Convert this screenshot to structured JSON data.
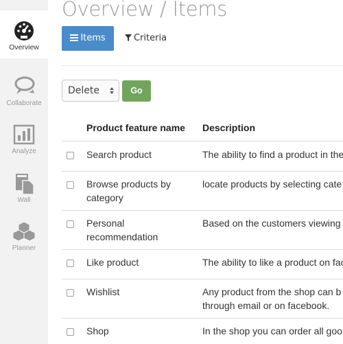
{
  "sidebar": {
    "items": [
      {
        "label": "Overview",
        "icon": "dashboard-icon",
        "active": true
      },
      {
        "label": "Collaborate",
        "icon": "chat-bubbles-icon",
        "active": false
      },
      {
        "label": "Analyze",
        "icon": "bar-chart-icon",
        "active": false
      },
      {
        "label": "Wall",
        "icon": "documents-icon",
        "active": false
      },
      {
        "label": "Planner",
        "icon": "boxes-icon",
        "active": false
      }
    ]
  },
  "header": {
    "title": "Overview / Items",
    "tabs": [
      {
        "label": "Items",
        "icon": "list-icon",
        "active": true
      },
      {
        "label": "Criteria",
        "icon": "filter-icon",
        "active": false
      }
    ]
  },
  "bulk_action": {
    "selected": "Delete",
    "go_label": "Go"
  },
  "table": {
    "columns": [
      "Product feature name",
      "Description"
    ],
    "rows": [
      {
        "name": "Search product",
        "description": "The ability to find a product in the"
      },
      {
        "name": "Browse products by category",
        "description": "locate products by selecting cate"
      },
      {
        "name": "Personal recommendation",
        "description": "Based on the customers viewing"
      },
      {
        "name": "Like product",
        "description": "The ability to like a product on fac"
      },
      {
        "name": "Wishlist",
        "description": "Any product from the shop can b through email or on facebook."
      },
      {
        "name": "Shop",
        "description": "In the shop you can order all goo"
      }
    ]
  },
  "colors": {
    "accent": "#4a8bc9",
    "go_button": "#72a55c",
    "sidebar_bg": "#f2f2f2"
  }
}
